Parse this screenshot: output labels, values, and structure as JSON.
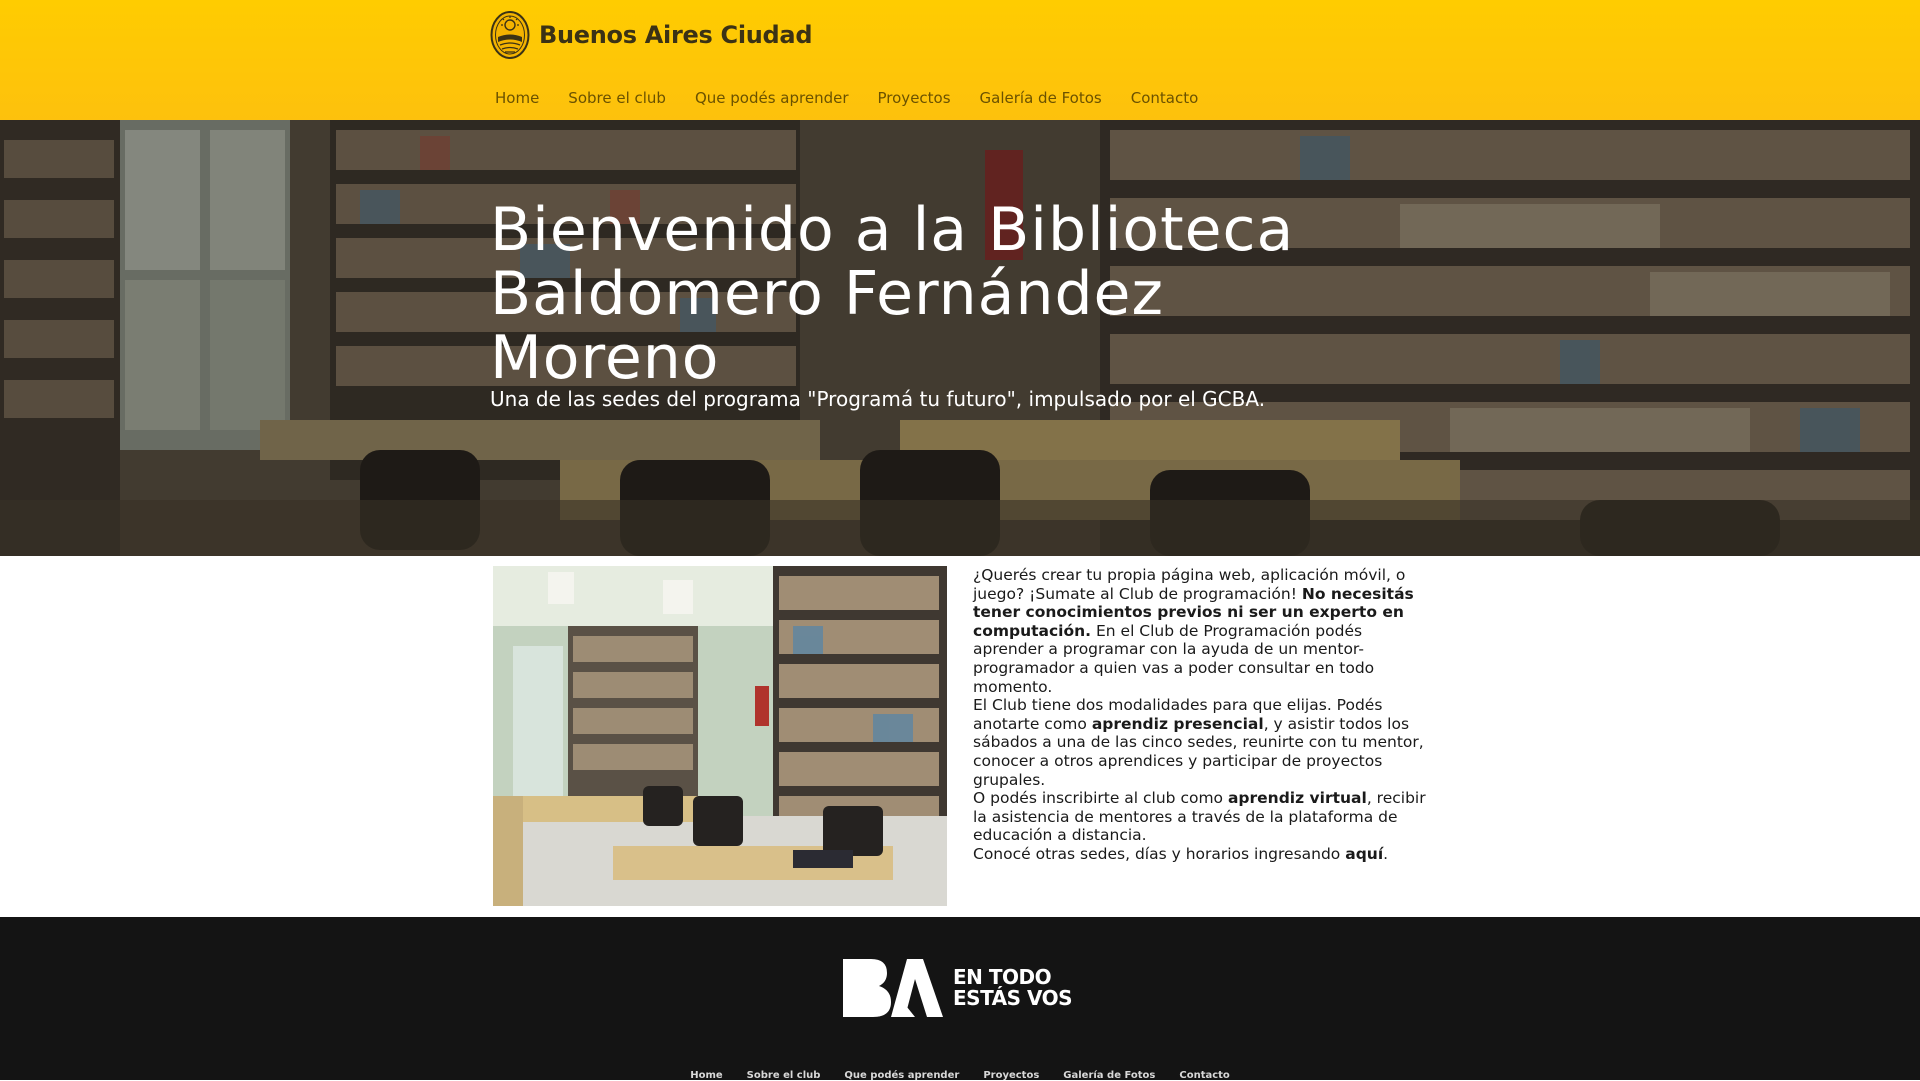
{
  "colors": {
    "header_background": "#ffcc00",
    "nav_link": "#6b5200",
    "footer_background": "#141414",
    "hero_text": "#ffffff"
  },
  "header": {
    "brand_name": "Buenos Aires Ciudad",
    "logo_icon": "city-seal-icon",
    "nav": [
      {
        "label": "Home"
      },
      {
        "label": "Sobre el club"
      },
      {
        "label": "Que podés aprender"
      },
      {
        "label": "Proyectos"
      },
      {
        "label": "Galería de Fotos"
      },
      {
        "label": "Contacto"
      }
    ]
  },
  "hero": {
    "title": "Bienvenido a la Biblioteca Baldomero Fernández Moreno",
    "subtitle": "Una de las sedes del programa \"Programá tu futuro\", impulsado por el GCBA."
  },
  "content": {
    "p1": {
      "a": "¿Querés crear tu propia página web, aplicación móvil, o juego? ¡Sumate al Club de programación! ",
      "b": "No necesitás tener conocimientos previos ni ser un experto en computación.",
      "c": " En el Club de Programación podés aprender a programar con la ayuda de un mentor-programador a quien vas a poder consultar en todo momento."
    },
    "p2": {
      "a": "El Club tiene dos modalidades para que elijas. Podés anotarte como ",
      "b": "aprendiz presencial",
      "c": ", y asistir todos los sábados a una de las cinco sedes, reunirte con tu mentor, conocer a otros aprendices y participar de proyectos grupales."
    },
    "p3": {
      "a": "O podés inscribirte al club como ",
      "b": "aprendiz virtual",
      "c": ", recibir la asistencia de mentores a través de la plataforma de educación a distancia."
    },
    "p4": {
      "a": "Conocé otras sedes, días y horarios ingresando ",
      "link": "aquí",
      "c": "."
    }
  },
  "footer": {
    "logo_mark": "BA",
    "slogan_line1": "EN TODO",
    "slogan_line2": "ESTÁS VOS",
    "nav": [
      {
        "label": "Home"
      },
      {
        "label": "Sobre el club"
      },
      {
        "label": "Que podés aprender"
      },
      {
        "label": "Proyectos"
      },
      {
        "label": "Galería de Fotos"
      },
      {
        "label": "Contacto"
      }
    ]
  }
}
